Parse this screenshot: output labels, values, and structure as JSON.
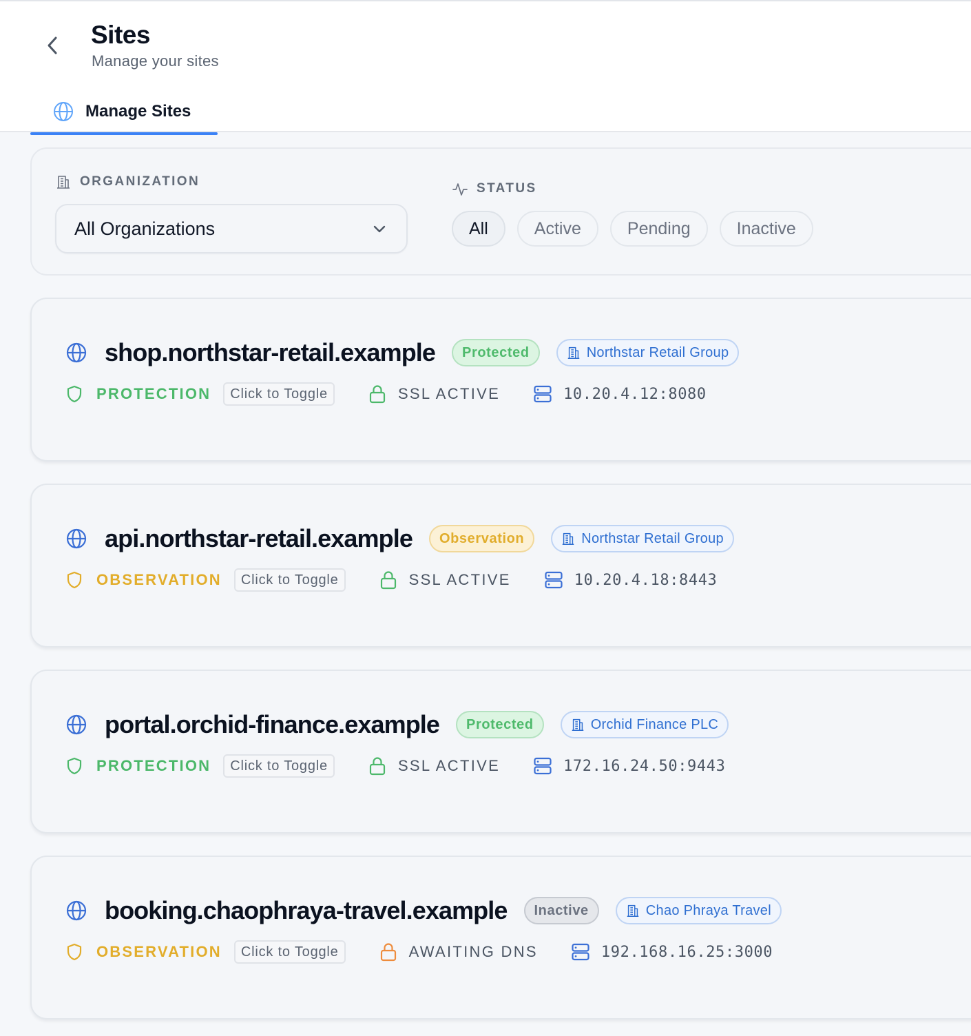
{
  "header": {
    "title": "Sites",
    "subtitle": "Manage your sites",
    "back_icon": "chevron-left-icon"
  },
  "tabs": [
    {
      "label": "Manage Sites",
      "icon": "globe-icon",
      "active": true
    }
  ],
  "filters": {
    "organization": {
      "label": "ORGANIZATION",
      "selected": "All Organizations"
    },
    "status": {
      "label": "STATUS",
      "options": [
        "All",
        "Active",
        "Pending",
        "Inactive"
      ],
      "selected": "All"
    }
  },
  "colors": {
    "accent": "#3b82f6",
    "protected": "#4cb86a",
    "observation": "#e2ad2b",
    "inactive": "#6b7280",
    "org_badge": "#2f6fd1",
    "awaiting_dns": "#ee8c3c"
  },
  "sites": [
    {
      "domain": "shop.northstar-retail.example",
      "status": "Protected",
      "organization": "Northstar Retail Group",
      "mode": "PROTECTION",
      "toggle_label": "Click to Toggle",
      "ssl": "SSL ACTIVE",
      "address": "10.20.4.12:8080"
    },
    {
      "domain": "api.northstar-retail.example",
      "status": "Observation",
      "organization": "Northstar Retail Group",
      "mode": "OBSERVATION",
      "toggle_label": "Click to Toggle",
      "ssl": "SSL ACTIVE",
      "address": "10.20.4.18:8443"
    },
    {
      "domain": "portal.orchid-finance.example",
      "status": "Protected",
      "organization": "Orchid Finance PLC",
      "mode": "PROTECTION",
      "toggle_label": "Click to Toggle",
      "ssl": "SSL ACTIVE",
      "address": "172.16.24.50:9443"
    },
    {
      "domain": "booking.chaophraya-travel.example",
      "status": "Inactive",
      "organization": "Chao Phraya Travel",
      "mode": "OBSERVATION",
      "toggle_label": "Click to Toggle",
      "ssl": "AWAITING DNS",
      "address": "192.168.16.25:3000"
    }
  ]
}
